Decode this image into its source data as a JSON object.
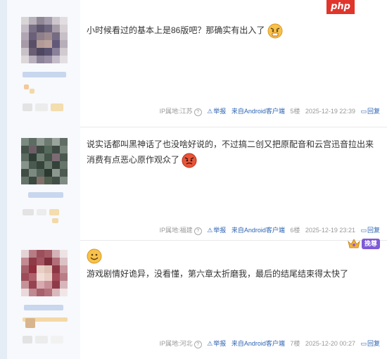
{
  "watermark": "php",
  "posts": [
    {
      "text": "小时候看过的基本上是86版吧？那确实有出入了",
      "ip_label": "IP属地:江苏",
      "report": "举报",
      "client": "来自Android客户端",
      "floor": "5楼",
      "time": "2025-12-19 22:39",
      "reply": "回复"
    },
    {
      "text": "说实话都叫黑神话了也没啥好说的，不过搞二创又把原配音和云宫迅音拉出来消费有点恶心原作观众了",
      "ip_label": "IP属地:福建",
      "report": "举报",
      "client": "来自Android客户端",
      "floor": "6楼",
      "time": "2025-12-19 23:21",
      "reply": "回复"
    },
    {
      "text": "游戏剧情好诡异，没看懂，第六章太折磨我，最后的结尾结束得太快了",
      "ip_label": "IP属地:河北",
      "report": "举报",
      "client": "来自Android客户端",
      "floor": "7楼",
      "time": "2025-12-20 00:27",
      "reply": "回复"
    }
  ],
  "vip_tag": "挽尊",
  "colors": {
    "link": "#2d64b3",
    "meta": "#999999",
    "sidebar": "#f7f9fc",
    "page_bg": "#e4ecf5"
  }
}
